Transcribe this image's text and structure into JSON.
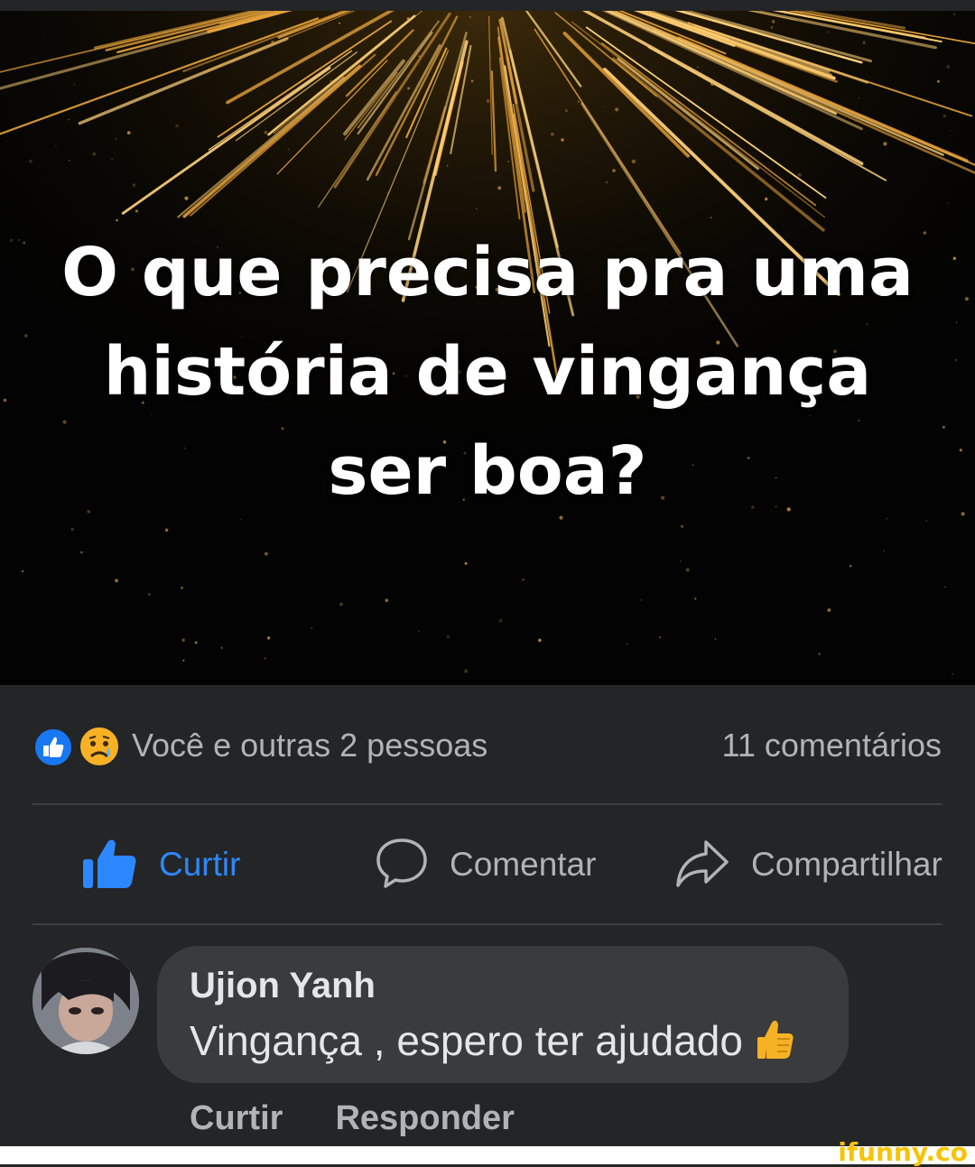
{
  "post": {
    "image_title": "O que precisa pra uma história de vingança ser boa?",
    "reactions_text": "Você e outras 2 pessoas",
    "comments_count": "11 comentários",
    "reaction_icons": [
      "like-icon",
      "sad-icon"
    ]
  },
  "actions": {
    "like_label": "Curtir",
    "comment_label": "Comentar",
    "share_label": "Compartilhar"
  },
  "comment": {
    "author": "Ujion Yanh",
    "text": "Vingança , espero ter ajudado",
    "emoji": "thumbs-up-emoji",
    "like_label": "Curtir",
    "reply_label": "Responder"
  },
  "watermark": "ifunny.co",
  "colors": {
    "background": "#242526",
    "bubble": "#3a3b3c",
    "accent_blue": "#2d88ff",
    "secondary_text": "#b0b3b8"
  }
}
